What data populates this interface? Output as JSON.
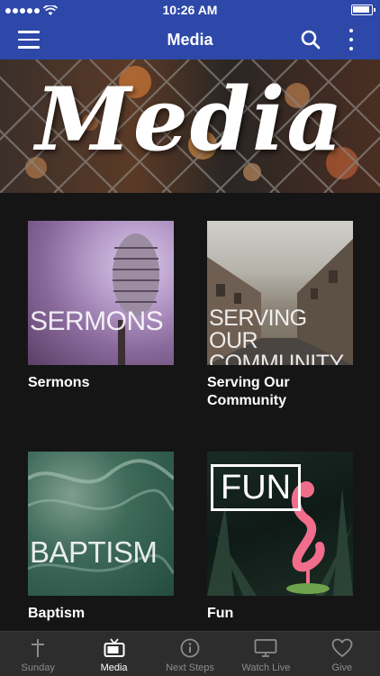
{
  "status_bar": {
    "time": "10:26 AM"
  },
  "header": {
    "title": "Media"
  },
  "banner": {
    "text": "Media"
  },
  "tiles": [
    {
      "thumb_text": "SERMONS",
      "caption": "Sermons"
    },
    {
      "thumb_text": "SERVING OUR COMMUNITY",
      "caption": "Serving Our Community"
    },
    {
      "thumb_text": "BAPTISM",
      "caption": "Baptism"
    },
    {
      "thumb_text": "FUN",
      "caption": "Fun"
    }
  ],
  "tabs": [
    {
      "label": "Sunday",
      "icon": "cross-icon",
      "active": false
    },
    {
      "label": "Media",
      "icon": "tv-icon",
      "active": true
    },
    {
      "label": "Next Steps",
      "icon": "info-icon",
      "active": false
    },
    {
      "label": "Watch Live",
      "icon": "monitor-icon",
      "active": false
    },
    {
      "label": "Give",
      "icon": "heart-icon",
      "active": false
    }
  ],
  "colors": {
    "header_bg": "#2d48a8",
    "tabbar_bg": "#2d2d2d",
    "page_bg": "#151515"
  }
}
